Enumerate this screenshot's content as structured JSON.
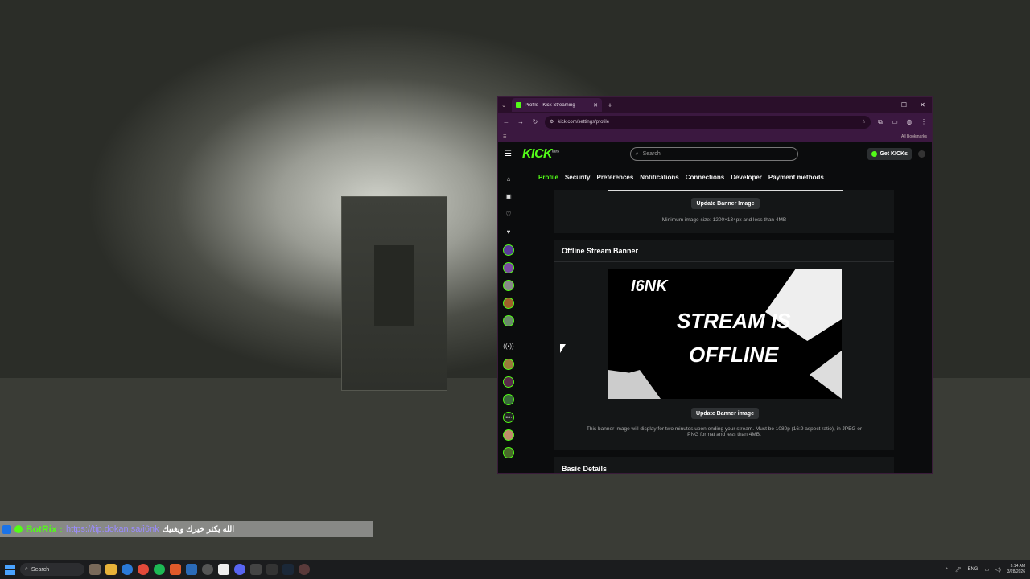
{
  "browser": {
    "tab_title": "Profile - Kick Streaming",
    "url": "kick.com/settings/profile",
    "bookmarks_label": "All Bookmarks",
    "window_controls": [
      "─",
      "☐",
      "✕"
    ]
  },
  "kick": {
    "logo": "KICK",
    "logo_sup": "BETA",
    "search_placeholder": "Search",
    "get_kicks": "Get KICKs",
    "settings_tabs": [
      "Profile",
      "Security",
      "Preferences",
      "Notifications",
      "Connections",
      "Developer",
      "Payment methods"
    ],
    "active_tab": "Profile"
  },
  "banner_section": {
    "update_button": "Update Banner Image",
    "note": "Minimum image size: 1200×134px and less than 4MB"
  },
  "offline_section": {
    "title": "Offline Stream Banner",
    "image_handle": "I6NK",
    "image_line1": "STREAM IS",
    "image_line2": "OFFLINE",
    "update_button": "Update Banner image",
    "note_line1": "This banner image will display for two minutes upon ending your stream. Must be 1080p (16:9 aspect ratio), in JPEG or",
    "note_line2": "PNG format and less than 4MB."
  },
  "basic_section": {
    "title": "Basic Details"
  },
  "sidebar": {
    "avatar_label": "tlish"
  },
  "chat": {
    "user": "BotRix :",
    "link": "https://tip.dokan.sa/i6nk",
    "message": "الله يكثر خيرك ويغنيك"
  },
  "taskbar": {
    "search": "Search",
    "lang": "ENG",
    "time": "3:14 AM",
    "date": "3/28/2026"
  }
}
